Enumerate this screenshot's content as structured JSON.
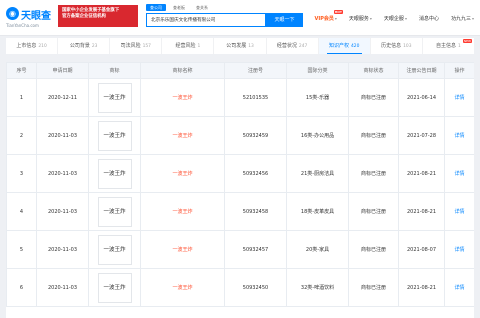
{
  "header": {
    "logo_text": "天眼查",
    "logo_sub": "TianYanCha.com",
    "banner_line1": "国家中小企业发展子基金旗下",
    "banner_line2": "官方备案企业征信机构",
    "search_tabs": [
      "查公司",
      "查老板",
      "查关系"
    ],
    "search_value": "北京乐乐国庆文化传播有限公司",
    "search_button": "天眼一下",
    "nav": {
      "vip": "VIP会员",
      "vip_badge": "HOT",
      "service": "天眼服务",
      "enterprise": "天眼企服",
      "message": "消息中心",
      "user": "功九九三"
    }
  },
  "tabs": [
    {
      "label": "上市信息",
      "count": "210"
    },
    {
      "label": "公司背景",
      "count": "23"
    },
    {
      "label": "司法风险",
      "count": "157"
    },
    {
      "label": "经营风险",
      "count": "1"
    },
    {
      "label": "公司发展",
      "count": "13"
    },
    {
      "label": "经营状况",
      "count": "247"
    },
    {
      "label": "知识产权",
      "count": "420"
    },
    {
      "label": "历史信息",
      "count": "103"
    },
    {
      "label": "自主信息",
      "count": "1",
      "tag": "NEW"
    }
  ],
  "table": {
    "headers": [
      "序号",
      "申请日期",
      "商标",
      "商标名称",
      "注册号",
      "国际分类",
      "商标状态",
      "注册公告日期",
      "操作"
    ],
    "rows": [
      {
        "no": "1",
        "date": "2020-12-11",
        "mark": "一波王炸",
        "name": "一波王炸",
        "reg": "52101535",
        "cls": "15类-乐器",
        "status": "商标已注册",
        "pub": "2021-06-14",
        "action": "详情"
      },
      {
        "no": "2",
        "date": "2020-11-03",
        "mark": "一波王炸",
        "name": "一波王炸",
        "reg": "50932459",
        "cls": "16类-办公用品",
        "status": "商标已注册",
        "pub": "2021-07-28",
        "action": "详情"
      },
      {
        "no": "3",
        "date": "2020-11-03",
        "mark": "一波王炸",
        "name": "一波王炸",
        "reg": "50932456",
        "cls": "21类-厨房洁具",
        "status": "商标已注册",
        "pub": "2021-08-21",
        "action": "详情"
      },
      {
        "no": "4",
        "date": "2020-11-03",
        "mark": "一波王炸",
        "name": "一波王炸",
        "reg": "50932458",
        "cls": "18类-皮革皮具",
        "status": "商标已注册",
        "pub": "2021-08-21",
        "action": "详情"
      },
      {
        "no": "5",
        "date": "2020-11-03",
        "mark": "一波王炸",
        "name": "一波王炸",
        "reg": "50932457",
        "cls": "20类-家具",
        "status": "商标已注册",
        "pub": "2021-08-07",
        "action": "详情"
      },
      {
        "no": "6",
        "date": "2020-11-03",
        "mark": "一波王炸",
        "name": "一波王炸",
        "reg": "50932450",
        "cls": "32类-啤酒饮料",
        "status": "商标已注册",
        "pub": "2021-08-21",
        "action": "详情"
      }
    ]
  }
}
